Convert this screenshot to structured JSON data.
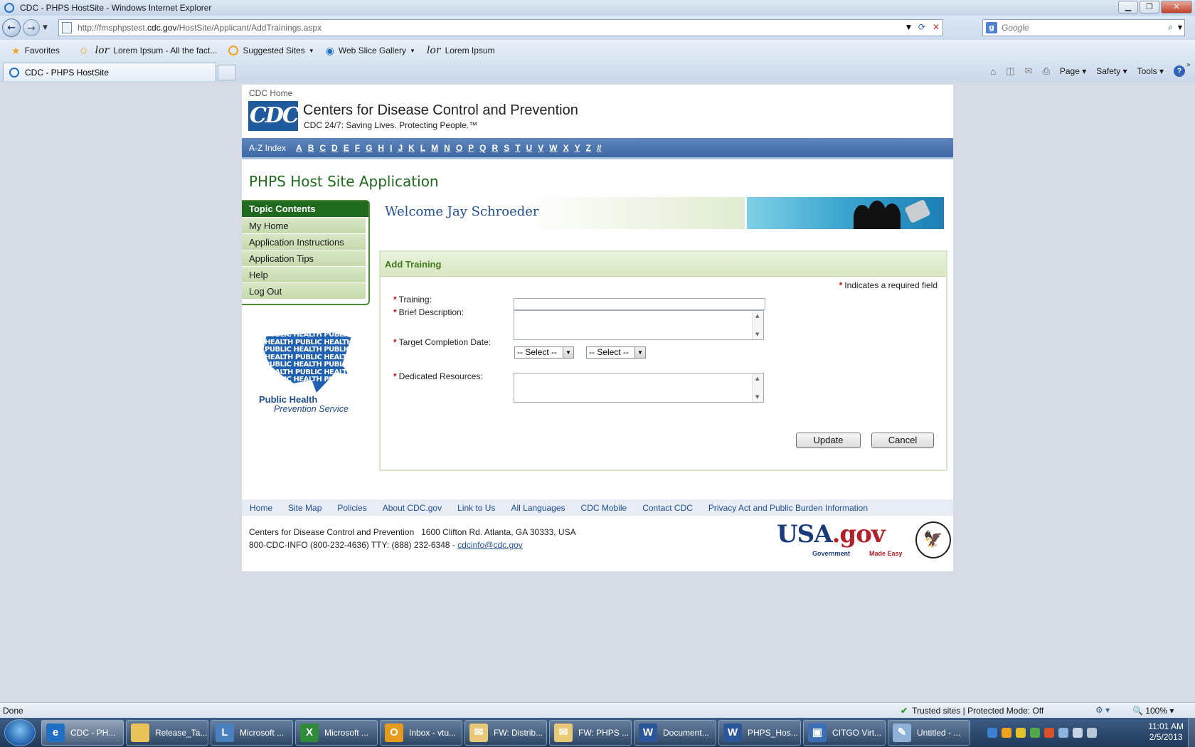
{
  "browser": {
    "window_title": "CDC - PHPS HostSite - Windows Internet Explorer",
    "url_prefix": "http://fmsphpstest.",
    "url_host": "cdc.gov",
    "url_path": "/HostSite/Applicant/AddTrainings.aspx",
    "search_placeholder": "Google",
    "favorites": [
      {
        "label": "Favorites"
      },
      {
        "label": "Lorem Ipsum - All the fact..."
      },
      {
        "label": "Suggested Sites"
      },
      {
        "label": "Web Slice Gallery"
      },
      {
        "label": "Lorem Ipsum"
      }
    ],
    "tab_title": "CDC - PHPS HostSite",
    "commands": [
      "Page",
      "Safety",
      "Tools"
    ]
  },
  "header": {
    "home_link": "CDC Home",
    "logo_text": "CDC",
    "org_name": "Centers for Disease Control and Prevention",
    "tagline": "CDC 24/7: Saving Lives. Protecting People.™"
  },
  "az_bar": {
    "label": "A-Z Index",
    "letters": [
      "A",
      "B",
      "C",
      "D",
      "E",
      "F",
      "G",
      "H",
      "I",
      "J",
      "K",
      "L",
      "M",
      "N",
      "O",
      "P",
      "Q",
      "R",
      "S",
      "T",
      "U",
      "V",
      "W",
      "X",
      "Y",
      "Z",
      "#"
    ]
  },
  "app_title": "PHPS Host Site Application",
  "sidebar": {
    "header": "Topic Contents",
    "items": [
      "My Home",
      "Application Instructions",
      "Application Tips",
      "Help",
      "Log Out"
    ],
    "logo_line1": "Public Health",
    "logo_line2": "Prevention Service",
    "logo_pattern": "PUBLIC HEALTH PUBLIC HEALTH PUBLIC HEALTH PUBLIC HEALTH PUBLIC HEALTH PUBLIC HEALTH PUBLIC HEALTH PUBLIC HEALTH PUBLIC HEALTH PUBLIC HEALTH PUBLIC HEALTH"
  },
  "welcome": "Welcome Jay Schroeder",
  "form": {
    "title": "Add Training",
    "required_note": "Indicates a required field",
    "required_mark": "*",
    "fields": {
      "training_label": "Training:",
      "training_value": "",
      "description_label": "Brief Description:",
      "target_date_label": "Target Completion Date:",
      "select1": "-- Select --",
      "select2": "-- Select --",
      "resources_label": "Dedicated Resources:"
    },
    "update_button": "Update",
    "cancel_button": "Cancel"
  },
  "footer": {
    "links": [
      "Home",
      "Site Map",
      "Policies",
      "About CDC.gov",
      "Link to Us",
      "All Languages",
      "CDC Mobile",
      "Contact CDC",
      "Privacy Act and Public Burden Information"
    ],
    "address_line1": "Centers for Disease Control and Prevention   1600 Clifton Rd. Atlanta, GA 30333, USA",
    "address_line2": "800-CDC-INFO (800-232-4636) TTY: (888) 232-6348 - ",
    "email": "cdcinfo@cdc.gov",
    "usagov_usa": "USA",
    "usagov_gov": ".gov",
    "usagov_sub1": "Government",
    "usagov_sub2": "Made Easy"
  },
  "status_bar": {
    "status": "Done",
    "zone": "Trusted sites | Protected Mode: Off",
    "zoom": "100%"
  },
  "taskbar": {
    "items": [
      {
        "label": "CDC - PH...",
        "icon_color": "#1f6fc5",
        "icon": "e"
      },
      {
        "label": "Release_Ta...",
        "icon_color": "#e9c35a",
        "icon": ""
      },
      {
        "label": "Microsoft ...",
        "icon_color": "#4a7fbf",
        "icon": "L"
      },
      {
        "label": "Microsoft ...",
        "icon_color": "#2e8b3a",
        "icon": "X"
      },
      {
        "label": "Inbox - vtu...",
        "icon_color": "#e69a1e",
        "icon": "O"
      },
      {
        "label": "FW: Distrib...",
        "icon_color": "#e8c978",
        "icon": "✉"
      },
      {
        "label": "FW: PHPS ...",
        "icon_color": "#e8c978",
        "icon": "✉"
      },
      {
        "label": "Document...",
        "icon_color": "#2b579a",
        "icon": "W"
      },
      {
        "label": "PHPS_Hos...",
        "icon_color": "#2b579a",
        "icon": "W"
      },
      {
        "label": "CITGO Virt...",
        "icon_color": "#3a6fb5",
        "icon": "▣"
      },
      {
        "label": "Untitled - ...",
        "icon_color": "#8fb3d8",
        "icon": "✎"
      }
    ],
    "time": "11:01 AM",
    "date": "2/5/2013"
  }
}
